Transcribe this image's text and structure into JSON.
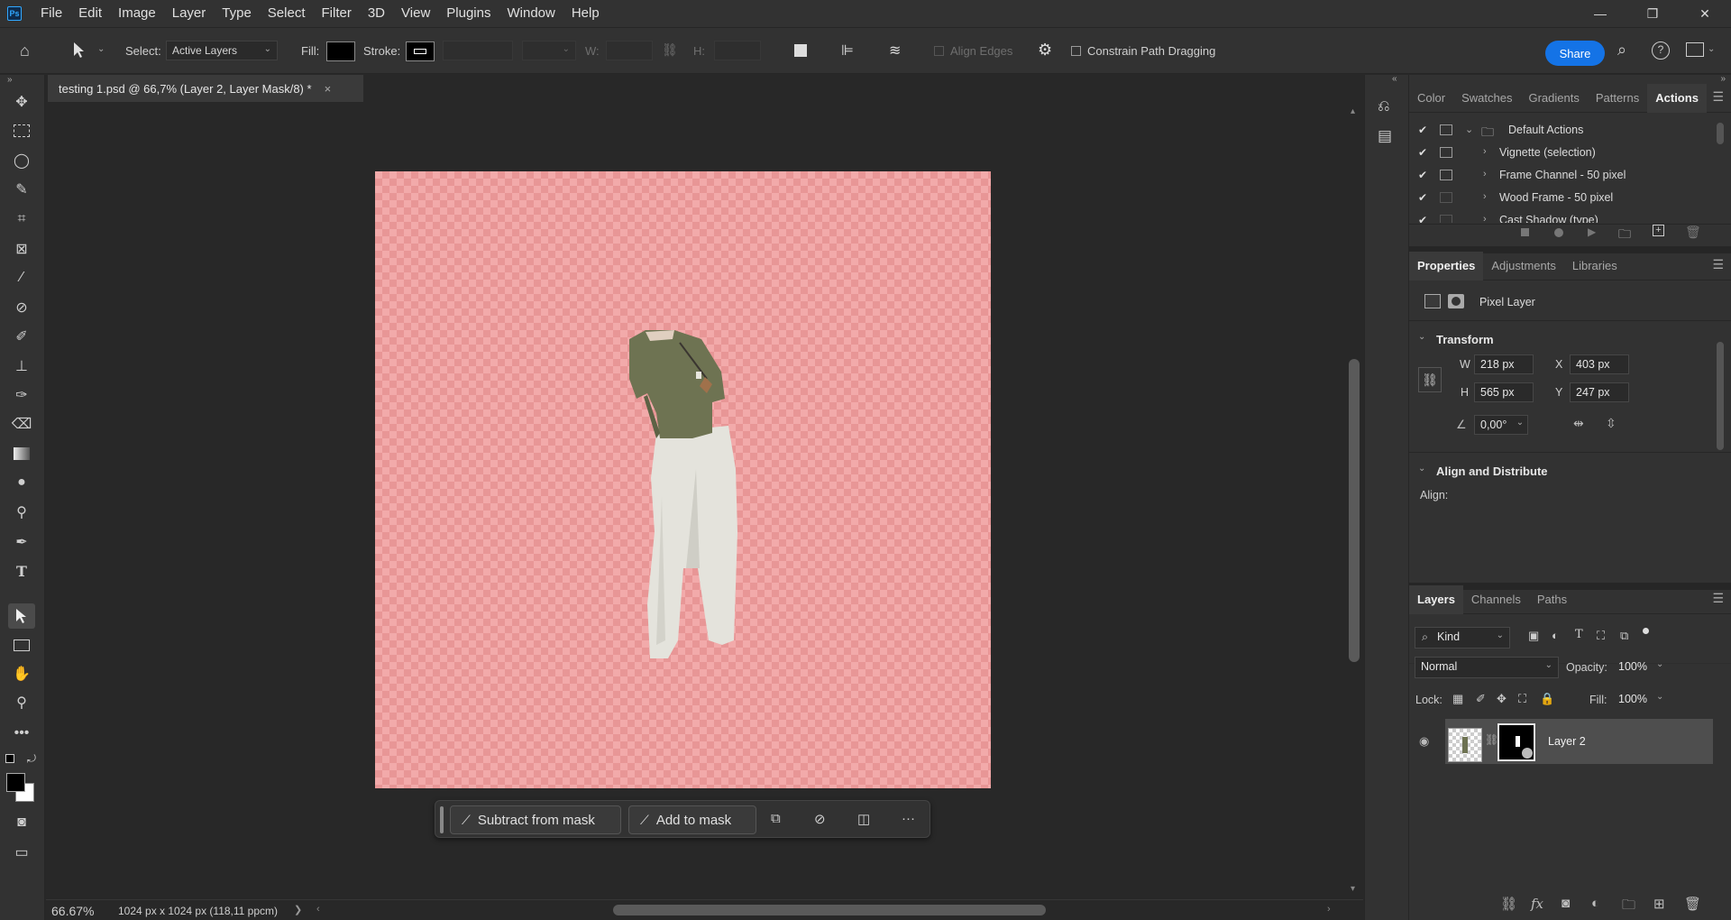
{
  "app": {
    "logo": "Ps"
  },
  "menu": [
    "File",
    "Edit",
    "Image",
    "Layer",
    "Type",
    "Select",
    "Filter",
    "3D",
    "View",
    "Plugins",
    "Window",
    "Help"
  ],
  "window_controls": {
    "minimize": "—",
    "restore": "❐",
    "close": "✕"
  },
  "options_bar": {
    "select_label": "Select:",
    "select_value": "Active Layers",
    "fill_label": "Fill:",
    "stroke_label": "Stroke:",
    "w_label": "W:",
    "h_label": "H:",
    "align_edges": "Align Edges",
    "constrain": "Constrain Path Dragging",
    "share": "Share",
    "fill_color": "#000000"
  },
  "document": {
    "tab_title": "testing 1.psd @ 66,7% (Layer 2, Layer Mask/8) *",
    "close": "×"
  },
  "taskbar": {
    "subtract": "Subtract from mask",
    "add": "Add to mask",
    "more": "···"
  },
  "status": {
    "zoom": "66.67%",
    "doc_info": "1024 px x 1024 px (118,11 ppcm)",
    "arrow": "❯"
  },
  "actions_panel": {
    "tabs": [
      "Color",
      "Swatches",
      "Gradients",
      "Patterns",
      "Actions"
    ],
    "active_tab": "Actions",
    "rows": [
      {
        "label": "Default Actions",
        "type": "folder",
        "checked": true,
        "dialog": true
      },
      {
        "label": "Vignette (selection)",
        "type": "action",
        "checked": true,
        "dialog": true
      },
      {
        "label": "Frame Channel - 50 pixel",
        "type": "action",
        "checked": true,
        "dialog": true
      },
      {
        "label": "Wood Frame - 50 pixel",
        "type": "action",
        "checked": true,
        "dialog": false
      },
      {
        "label": "Cast Shadow (type)",
        "type": "action",
        "checked": true,
        "dialog": false
      }
    ]
  },
  "properties_panel": {
    "tabs": [
      "Properties",
      "Adjustments",
      "Libraries"
    ],
    "active_tab": "Properties",
    "layer_type": "Pixel Layer",
    "transform_title": "Transform",
    "w_label": "W",
    "w": "218 px",
    "h_label": "H",
    "h": "565 px",
    "x_label": "X",
    "x": "403 px",
    "y_label": "Y",
    "y": "247 px",
    "angle": "0,00°",
    "align_title": "Align and Distribute",
    "align_label": "Align:"
  },
  "layers_panel": {
    "tabs": [
      "Layers",
      "Channels",
      "Paths"
    ],
    "active_tab": "Layers",
    "filter_kind": "Kind",
    "blend_mode": "Normal",
    "opacity_label": "Opacity:",
    "opacity": "100%",
    "lock_label": "Lock:",
    "fill_label": "Fill:",
    "fill": "100%",
    "layers": [
      {
        "name": "Layer 2",
        "visible": true,
        "has_mask": true,
        "selected": true
      }
    ]
  },
  "colors": {
    "accent": "#1473e6",
    "canvas_check_light": "#f2aaaa",
    "canvas_check_dark": "#e89696",
    "shirt": "#6e7352",
    "pants": "#e4e3dc"
  }
}
